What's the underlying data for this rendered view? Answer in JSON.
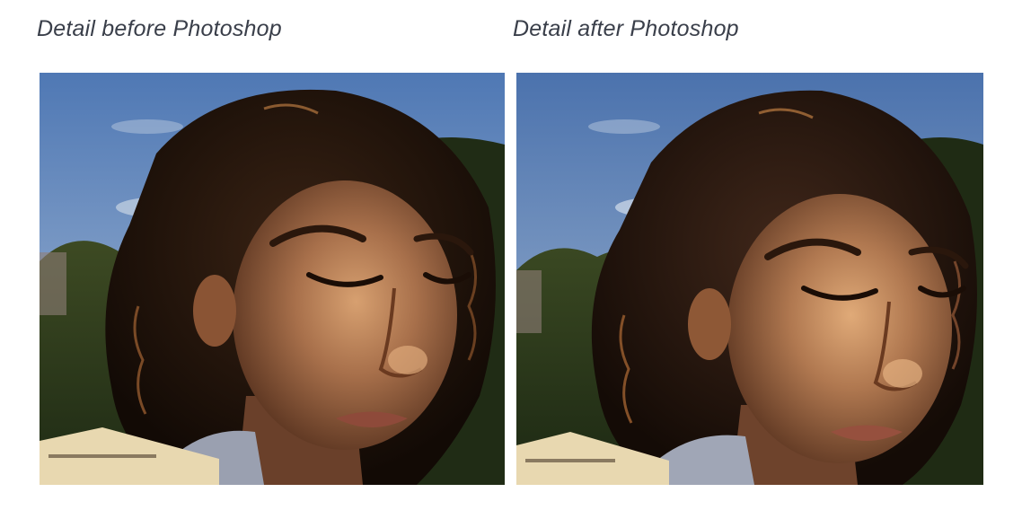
{
  "panels": [
    {
      "caption": "Detail before Photoshop",
      "image": "portrait-before"
    },
    {
      "caption": "Detail after Photoshop",
      "image": "portrait-after"
    }
  ]
}
